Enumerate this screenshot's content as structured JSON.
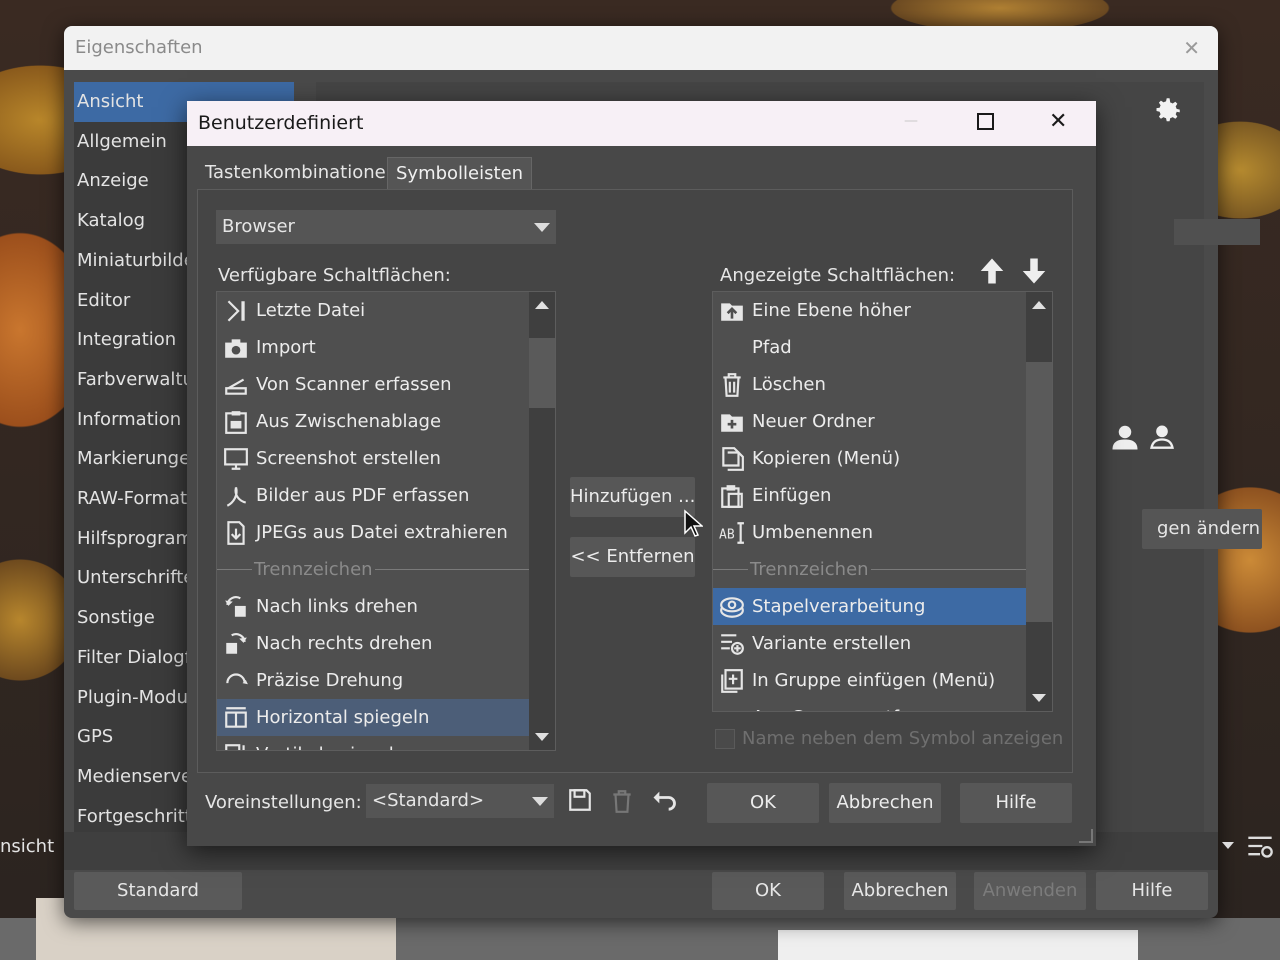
{
  "outer": {
    "title": "Eigenschaften",
    "close_glyph": "✕",
    "nav": [
      "Ansicht",
      "Allgemein",
      "Anzeige",
      "Katalog",
      "Miniaturbilder",
      "Editor",
      "Integration",
      "Farbverwaltung",
      "Information",
      "Markierungen",
      "RAW-Format",
      "Hilfsprogramme",
      "Unterschriften",
      "Sonstige",
      "Filter Dialogfeld",
      "Plugin-Module",
      "GPS",
      "Medienserver",
      "Fortgeschritten"
    ],
    "nav_selected": "Ansicht",
    "side_button": "gen ändern",
    "bottom_left_partial": "nsicht",
    "buttons": {
      "standard": "Standard",
      "ok": "OK",
      "cancel": "Abbrechen",
      "apply": "Anwenden",
      "help": "Hilfe"
    }
  },
  "dialog": {
    "title": "Benutzerdefiniert",
    "tabs": [
      "Tastenkombinationen",
      "Symbolleisten"
    ],
    "active_tab": "Symbolleisten",
    "toolbar_select": "Browser",
    "available_label": "Verfügbare Schaltflächen:",
    "shown_label": "Angezeigte Schaltflächen:",
    "available": [
      {
        "label": "Letzte Datei",
        "icon": "last-file-icon"
      },
      {
        "label": "Import",
        "icon": "camera-icon"
      },
      {
        "label": "Von Scanner erfassen",
        "icon": "scanner-icon"
      },
      {
        "label": "Aus Zwischenablage",
        "icon": "clipboard-icon"
      },
      {
        "label": "Screenshot erstellen",
        "icon": "monitor-icon"
      },
      {
        "label": "Bilder aus PDF erfassen",
        "icon": "pdf-icon"
      },
      {
        "label": "JPEGs aus Datei extrahieren",
        "icon": "extract-icon"
      },
      {
        "label": "Trennzeichen",
        "separator": true
      },
      {
        "label": "Nach links drehen",
        "icon": "rotate-left-icon"
      },
      {
        "label": "Nach rechts drehen",
        "icon": "rotate-right-icon"
      },
      {
        "label": "Präzise Drehung",
        "icon": "rotate-precise-icon"
      },
      {
        "label": "Horizontal spiegeln",
        "icon": "flip-horizontal-icon",
        "selected": true
      },
      {
        "label": "Vertikal spiegeln",
        "icon": "flip-vertical-icon"
      }
    ],
    "shown": [
      {
        "label": "Eine Ebene höher",
        "icon": "folder-up-icon"
      },
      {
        "label": "Pfad",
        "icon": ""
      },
      {
        "label": "Löschen",
        "icon": "trash-icon"
      },
      {
        "label": "Neuer Ordner",
        "icon": "new-folder-icon"
      },
      {
        "label": "Kopieren (Menü)",
        "icon": "copy-icon"
      },
      {
        "label": "Einfügen",
        "icon": "paste-icon"
      },
      {
        "label": "Umbenennen",
        "icon": "rename-icon"
      },
      {
        "label": "Trennzeichen",
        "separator": true
      },
      {
        "label": "Stapelverarbeitung",
        "icon": "batch-icon",
        "selected": true
      },
      {
        "label": "Variante erstellen",
        "icon": "variant-icon"
      },
      {
        "label": "In Gruppe einfügen (Menü)",
        "icon": "group-add-icon"
      },
      {
        "label": "Aus Gruppe entfernen",
        "icon": "group-remove-icon"
      }
    ],
    "add_button": "Hinzufügen ...",
    "remove_button": "<< Entfernen",
    "show_name_checkbox": "Name neben dem Symbol anzeigen",
    "presets_label": "Voreinstellungen:",
    "presets_value": "<Standard>",
    "ok": "OK",
    "cancel": "Abbrechen",
    "help": "Hilfe",
    "window_controls": {
      "minimize": "—",
      "maximize": "☐",
      "close": "✕"
    }
  }
}
